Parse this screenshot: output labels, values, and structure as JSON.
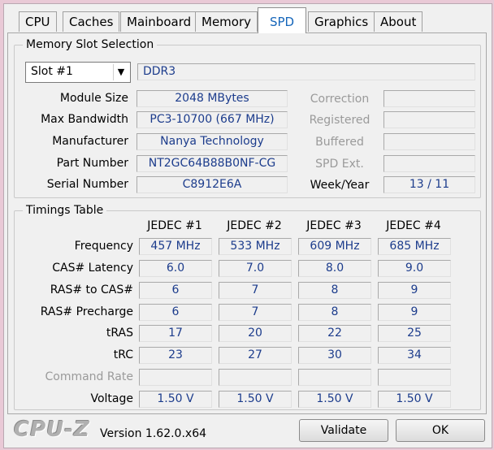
{
  "tabs": [
    "CPU",
    "Caches",
    "Mainboard",
    "Memory",
    "SPD",
    "Graphics",
    "About"
  ],
  "active_tab": "SPD",
  "slot_section": {
    "title": "Memory Slot Selection",
    "slot_value": "Slot #1",
    "type_value": "DDR3",
    "module_size_label": "Module Size",
    "module_size_value": "2048 MBytes",
    "max_bandwidth_label": "Max Bandwidth",
    "max_bandwidth_value": "PC3-10700 (667 MHz)",
    "manufacturer_label": "Manufacturer",
    "manufacturer_value": "Nanya Technology",
    "part_number_label": "Part Number",
    "part_number_value": "NT2GC64B88B0NF-CG",
    "serial_number_label": "Serial Number",
    "serial_number_value": "C8912E6A",
    "correction_label": "Correction",
    "registered_label": "Registered",
    "buffered_label": "Buffered",
    "spd_ext_label": "SPD Ext.",
    "week_year_label": "Week/Year",
    "week_year_value": "13 / 11"
  },
  "timings": {
    "title": "Timings Table",
    "columns": [
      "JEDEC #1",
      "JEDEC #2",
      "JEDEC #3",
      "JEDEC #4"
    ],
    "rows": [
      {
        "label": "Frequency",
        "values": [
          "457 MHz",
          "533 MHz",
          "609 MHz",
          "685 MHz"
        ]
      },
      {
        "label": "CAS# Latency",
        "values": [
          "6.0",
          "7.0",
          "8.0",
          "9.0"
        ]
      },
      {
        "label": "RAS# to CAS#",
        "values": [
          "6",
          "7",
          "8",
          "9"
        ]
      },
      {
        "label": "RAS# Precharge",
        "values": [
          "6",
          "7",
          "8",
          "9"
        ]
      },
      {
        "label": "tRAS",
        "values": [
          "17",
          "20",
          "22",
          "25"
        ]
      },
      {
        "label": "tRC",
        "values": [
          "23",
          "27",
          "30",
          "34"
        ]
      },
      {
        "label": "Command Rate",
        "values": [
          "",
          "",
          "",
          ""
        ]
      },
      {
        "label": "Voltage",
        "values": [
          "1.50 V",
          "1.50 V",
          "1.50 V",
          "1.50 V"
        ]
      }
    ]
  },
  "footer": {
    "logo": "CPU-Z",
    "version": "Version 1.62.0.x64",
    "validate_label": "Validate",
    "ok_label": "OK"
  }
}
